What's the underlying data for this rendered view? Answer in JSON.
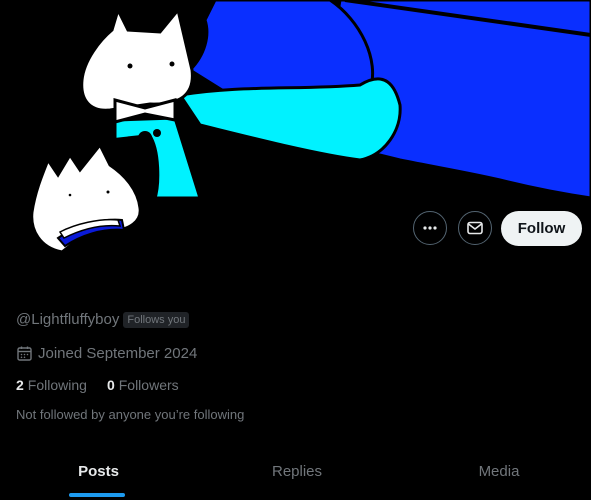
{
  "profile": {
    "handle": "@Lightfluffyboy",
    "follows_you_badge": "Follows you",
    "joined": "Joined September 2024",
    "following_count": "2",
    "following_label": "Following",
    "followers_count": "0",
    "followers_label": "Followers",
    "not_followed_text": "Not followed by anyone you’re following"
  },
  "actions": {
    "more_icon": "ellipsis-icon",
    "message_icon": "envelope-icon",
    "follow_label": "Follow"
  },
  "tabs": [
    {
      "label": "Posts",
      "active": true
    },
    {
      "label": "Replies",
      "active": false
    },
    {
      "label": "Media",
      "active": false
    }
  ],
  "colors": {
    "accent": "#1d9bf0",
    "follow_button_bg": "#eff3f4",
    "banner_blue": "#0a2fff",
    "banner_cyan": "#00f2ff"
  }
}
